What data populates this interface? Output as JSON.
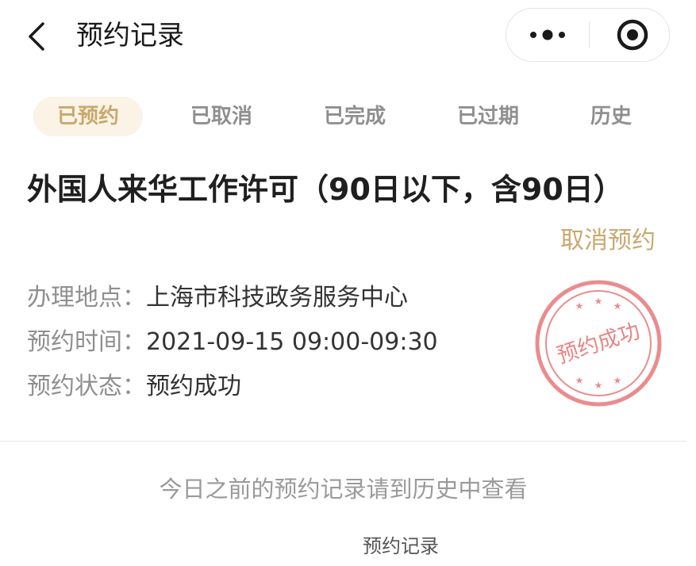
{
  "header": {
    "title": "预约记录",
    "back_icon": "chevron-left-icon",
    "more_icon": "more-dots-icon",
    "close_icon": "target-close-icon"
  },
  "tabs": [
    {
      "label": "已预约",
      "active": true
    },
    {
      "label": "已取消",
      "active": false
    },
    {
      "label": "已完成",
      "active": false
    },
    {
      "label": "已过期",
      "active": false
    },
    {
      "label": "历史",
      "active": false
    }
  ],
  "appointment": {
    "title": "外国人来华工作许可（90日以下，含90日）",
    "cancel_label": "取消预约",
    "location_label": "办理地点：",
    "location_value": "上海市科技政务服务中心",
    "time_label": "预约时间：",
    "time_value": "2021-09-15 09:00-09:30",
    "status_label": "预约状态：",
    "status_value": "预约成功",
    "stamp_text": "预约成功"
  },
  "footnote": "今日之前的预约记录请到历史中查看",
  "bottom_label": "预约记录",
  "colors": {
    "accent": "#c8a96e",
    "accent_bg": "#faf3e6",
    "stamp_red": "#e6787a",
    "muted": "#8f8f8f"
  }
}
